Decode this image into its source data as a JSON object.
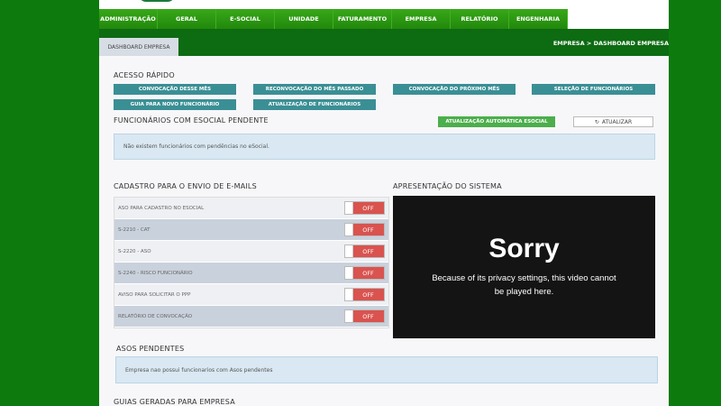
{
  "nav": {
    "items": [
      "ADMINISTRAÇÃO",
      "GERAL",
      "E-SOCIAL",
      "UNIDADE",
      "FATURAMENTO",
      "EMPRESA",
      "RELATÓRIO",
      "ENGENHARIA"
    ]
  },
  "tab": {
    "label": "DASHBOARD EMPRESA"
  },
  "breadcrumb": "EMPRESA > DASHBOARD EMPRESA",
  "quick_access": {
    "title": "ACESSO RÁPIDO",
    "buttons": [
      "CONVOCAÇÃO DESSE MÊS",
      "RECONVOCAÇÃO DO MÊS PASSADO",
      "CONVOCAÇÃO DO PRÓXIMO MÊS",
      "SELEÇÃO DE FUNCIONÁRIOS",
      "GUIA PARA NOVO FUNCIONÁRIO",
      "ATUALIZAÇÃO DE FUNCIONÁRIOS"
    ]
  },
  "esocial": {
    "title": "FUNCIONÁRIOS COM ESOCIAL PENDENTE",
    "auto_update_label": "ATUALIZAÇÃO AUTOMÁTICA ESOCIAL",
    "refresh_label": "ATUALIZAR",
    "message": "Não existem funcionários com pendências no eSocial."
  },
  "email_registration": {
    "title": "CADASTRO PARA O ENVIO DE E-MAILS",
    "rows": [
      {
        "label": "ASO PARA CADASTRO NO ESOCIAL",
        "state": "Off"
      },
      {
        "label": "S-2210 - CAT",
        "state": "Off"
      },
      {
        "label": "S-2220 - ASO",
        "state": "Off"
      },
      {
        "label": "S-2240 - RISCO FUNCIONÁRIO",
        "state": "Off"
      },
      {
        "label": "AVISO PARA SOLICITAR O PPP",
        "state": "Off"
      },
      {
        "label": "RELATÓRIO DE CONVOCAÇÃO",
        "state": "Off"
      }
    ]
  },
  "presentation": {
    "title": "APRESENTAÇÃO DO SISTEMA",
    "video_title": "Sorry",
    "video_message": "Because of its privacy settings, this video cannot be played here."
  },
  "pending_asos": {
    "title": "ASOS PENDENTES",
    "message": "Empresa nao possui funcionarios com Asos pendentes"
  },
  "guides": {
    "title": "GUIAS GERADAS PARA EMPRESA"
  },
  "colors": {
    "outer_bg": "#0d7a0d",
    "nav": "#2e9a12",
    "quick_btn": "#3a8f95",
    "toggle_off": "#d9534f",
    "info_bg": "#d9e8f2"
  }
}
